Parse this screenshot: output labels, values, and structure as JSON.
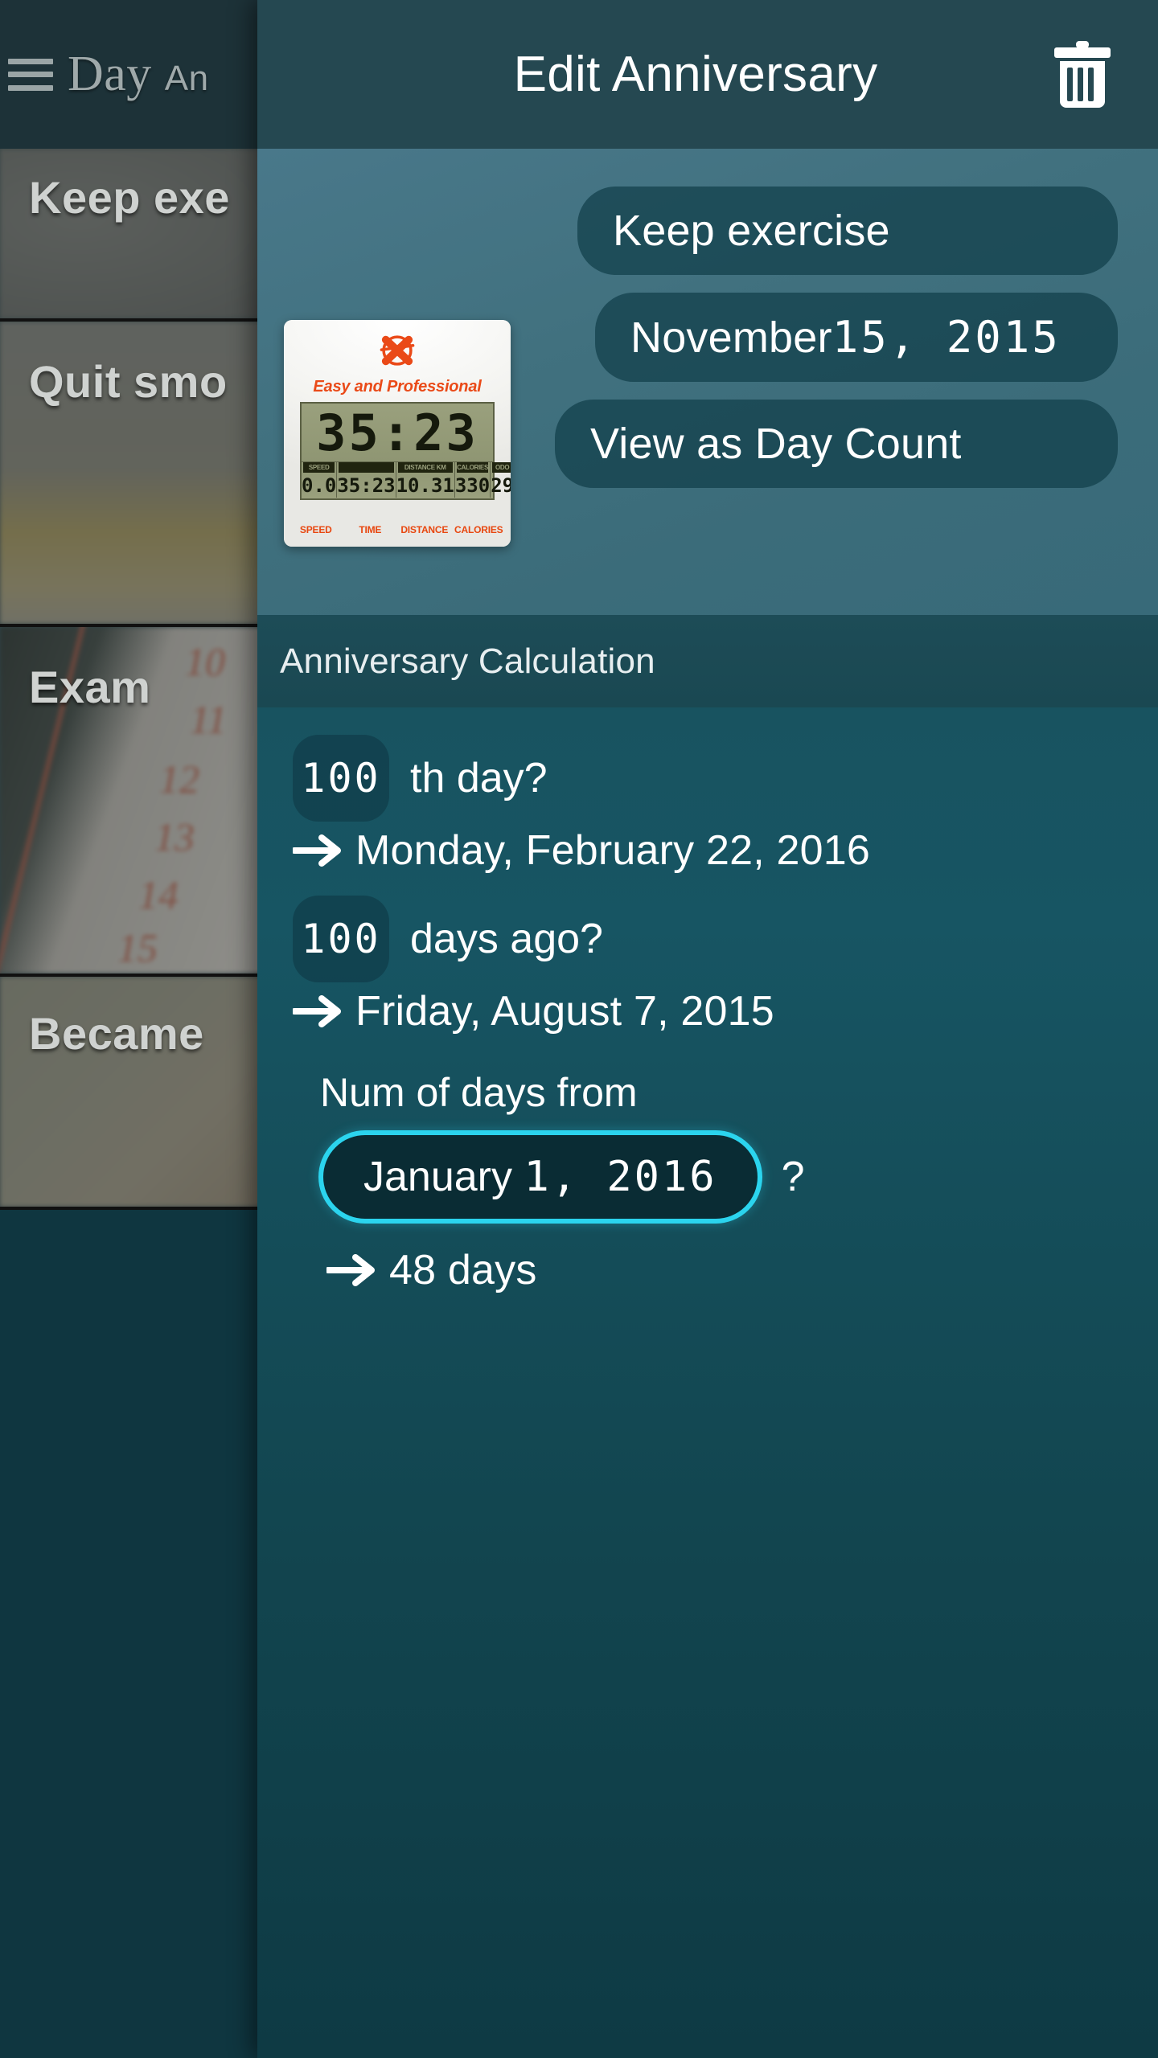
{
  "background_screen": {
    "menu_icon": "hamburger-menu-icon",
    "app_title": "Day",
    "app_title_sub": "An",
    "list_items": [
      {
        "title": "Keep exe",
        "photo": "gym-equipment-photo"
      },
      {
        "title": "Quit smo",
        "photo": "yellow-food-photo"
      },
      {
        "title": "Exam",
        "photo": "calendar-photo"
      },
      {
        "title": "Became",
        "photo": "beige-photo"
      }
    ],
    "calendar_numbers": [
      "10",
      "11",
      "12",
      "13",
      "14",
      "15"
    ]
  },
  "appbar": {
    "title": "Edit Anniversary",
    "delete_icon": "trash-icon"
  },
  "header": {
    "thumbnail": {
      "name": "anniversary-photo",
      "brand_logo": "x-circle-logo",
      "brand_text": "Easy and Professional",
      "lcd_main": "35:23",
      "lcd_cells": [
        {
          "tag": "SPEED",
          "value": "0.0"
        },
        {
          "tag": "",
          "value": "35:23"
        },
        {
          "tag": "DISTANCE KM",
          "value": "10.31"
        },
        {
          "tag": "CALORIES",
          "value": "330"
        },
        {
          "tag": "ODO",
          "value": "29"
        }
      ],
      "footer_labels": [
        "SPEED",
        "TIME",
        "DISTANCE",
        "CALORIES"
      ]
    },
    "title_chip": "Keep exercise",
    "date_chip_month": "November ",
    "date_chip_digits": "15, 2015",
    "view_mode_chip": "View as Day Count"
  },
  "section": {
    "title": "Anniversary Calculation"
  },
  "calculation": {
    "rows": [
      {
        "number": "100",
        "question": "th day?",
        "arrow_icon": "arrow-right-icon",
        "answer": "Monday, February 22, 2016"
      },
      {
        "number": "100",
        "question": "days ago?",
        "arrow_icon": "arrow-right-icon",
        "answer": "Friday, August 7, 2015"
      }
    ],
    "num_days_label": "Num of days from",
    "from_date_month": "January ",
    "from_date_digits": "1, 2016",
    "question_mark": "?",
    "result_arrow_icon": "arrow-right-icon",
    "result": "48 days"
  },
  "colors": {
    "accent_highlight": "#2bd4ee",
    "appbar": "#254851",
    "panel_top": "#49788a",
    "panel_bottom": "#0e3a44",
    "brand_orange": "#ea4a18",
    "lcd_green": "#9aa07d"
  }
}
